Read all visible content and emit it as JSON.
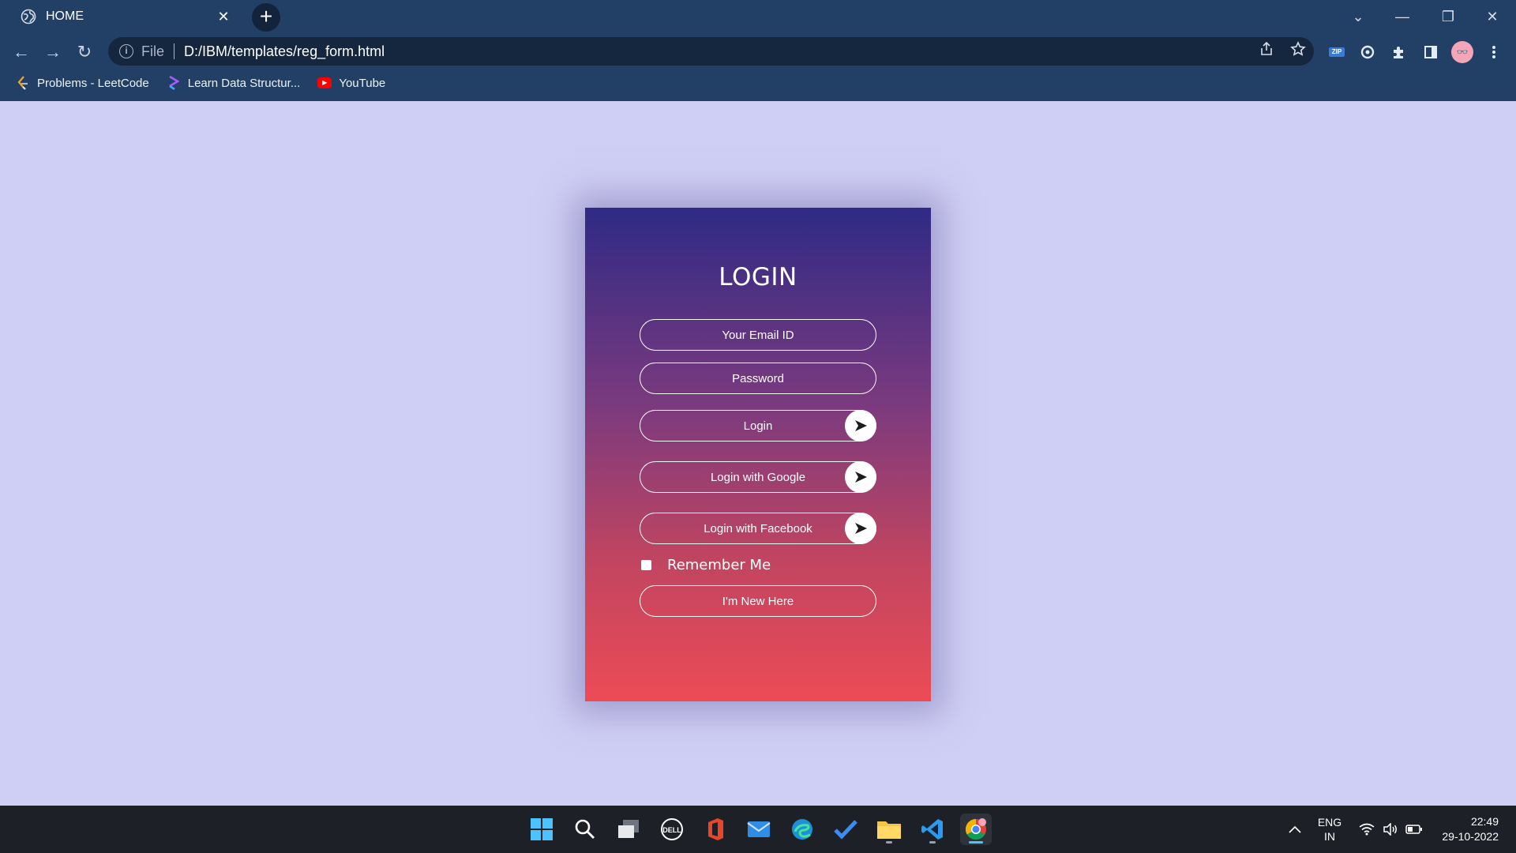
{
  "browser": {
    "tab": {
      "title": "HOME",
      "close_glyph": "✕"
    },
    "new_tab_glyph": "+",
    "window_controls": {
      "dropdown": "⌄",
      "minimize": "—",
      "restore": "❐",
      "close": "✕"
    },
    "nav": {
      "back": "←",
      "forward": "→",
      "reload": "↻"
    },
    "address": {
      "info_glyph": "i",
      "scheme": "File",
      "url": "D:/IBM/templates/reg_form.html"
    },
    "bookmarks": [
      {
        "label": "Problems - LeetCode",
        "icon": "leetcode-icon"
      },
      {
        "label": "Learn Data Structur...",
        "icon": "codestudio-icon"
      },
      {
        "label": "YouTube",
        "icon": "youtube-icon"
      }
    ]
  },
  "login": {
    "title": "LOGIN",
    "email_placeholder": "Your Email ID",
    "password_placeholder": "Password",
    "login_label": "Login",
    "google_label": "Login with Google",
    "facebook_label": "Login with Facebook",
    "remember_label": "Remember Me",
    "new_label": "I'm New Here"
  },
  "taskbar": {
    "apps": [
      "windows-start-icon",
      "search-icon",
      "task-view-icon",
      "dell-icon",
      "office-icon",
      "mail-icon",
      "edge-icon",
      "todo-icon",
      "file-explorer-icon",
      "vscode-icon",
      "chrome-icon"
    ],
    "language": {
      "line1": "ENG",
      "line2": "IN"
    },
    "time": "22:49",
    "date": "29-10-2022"
  },
  "colors": {
    "chrome": "#223f66",
    "page_bg": "#cfcef4",
    "card_top": "#2f2a85",
    "card_bottom": "#ec4b55",
    "taskbar": "#1d2027"
  }
}
